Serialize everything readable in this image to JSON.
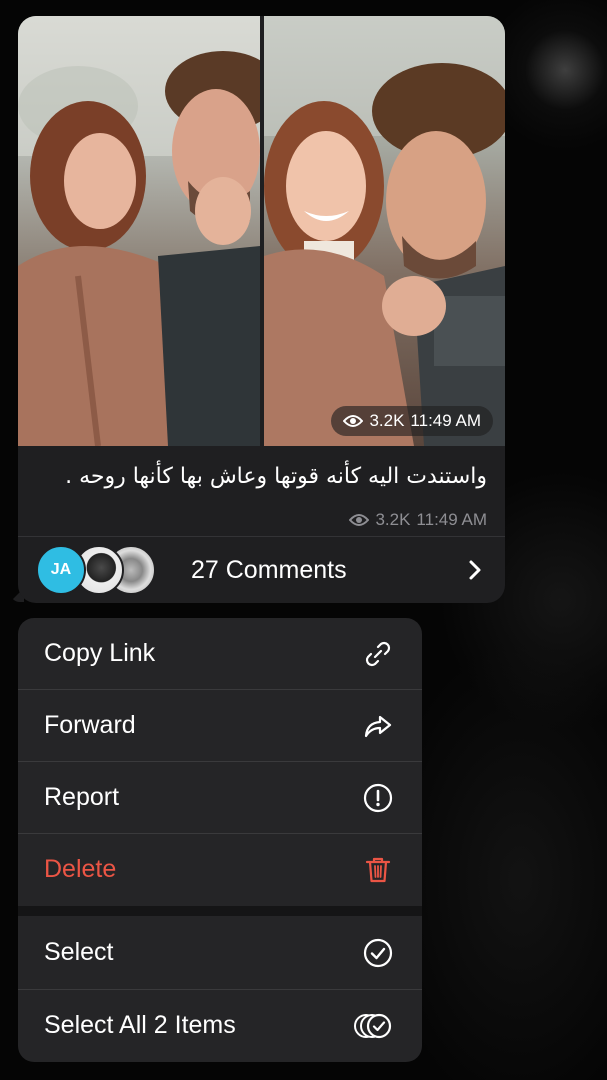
{
  "message": {
    "photo_views": "3.2K",
    "photo_time": "11:49 AM",
    "caption": "واستندت اليه كأنه قوتها وعاش بها كأنها روحه .",
    "caption_views": "3.2K",
    "caption_time": "11:49 AM",
    "comments_label": "27 Comments",
    "avatar_initials": "JA"
  },
  "menu": {
    "items": [
      {
        "label": "Copy Link",
        "icon": "link-icon"
      },
      {
        "label": "Forward",
        "icon": "forward-arrow-icon"
      },
      {
        "label": "Report",
        "icon": "exclamation-circle-icon"
      },
      {
        "label": "Delete",
        "icon": "trash-icon"
      },
      {
        "label": "Select",
        "icon": "check-circle-icon"
      },
      {
        "label": "Select All 2 Items",
        "icon": "multi-check-circle-icon"
      }
    ]
  },
  "colors": {
    "bubble": "#1f1f21",
    "menu": "#252527",
    "danger": "#eb5545",
    "avatar": "#2fbde3",
    "muted": "#8e8e93"
  }
}
